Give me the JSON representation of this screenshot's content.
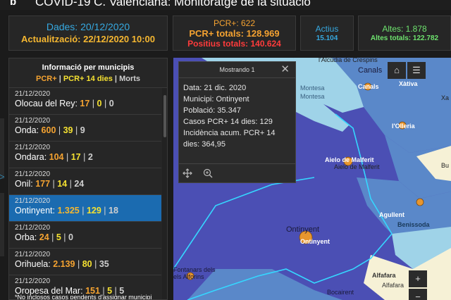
{
  "header": {
    "title": "COVID-19 C. Valenciana: Monitoratge de la situació",
    "logo": "b"
  },
  "dates": {
    "dades": "Dades: 20/12/2020",
    "actualitzacio": "Actualització: 22/12/2020 10:00"
  },
  "pcr": {
    "today": "PCR+: 622",
    "total": "PCR+ totals: 128.969",
    "positius": "Positius totals: 140.624"
  },
  "actius": {
    "label": "Actius",
    "value": "15.104"
  },
  "altes": {
    "label": "Altes: 1.878",
    "total": "Altes totals: 122.782"
  },
  "list": {
    "title": "Informació per municipis",
    "legend": {
      "a": "PCR+",
      "b": "PCR+ 14 dies",
      "c": "Morts",
      "sep": " | "
    },
    "rows": [
      {
        "date": "21/12/2020",
        "name": "Olocau del Rey:",
        "v1": "17",
        "v2": "0",
        "v3": "0"
      },
      {
        "date": "21/12/2020",
        "name": "Onda:",
        "v1": "600",
        "v2": "39",
        "v3": "9"
      },
      {
        "date": "21/12/2020",
        "name": "Ondara:",
        "v1": "104",
        "v2": "17",
        "v3": "2"
      },
      {
        "date": "21/12/2020",
        "name": "Onil:",
        "v1": "177",
        "v2": "14",
        "v3": "24"
      },
      {
        "date": "21/12/2020",
        "name": "Ontinyent:",
        "v1": "1.325",
        "v2": "129",
        "v3": "18"
      },
      {
        "date": "21/12/2020",
        "name": "Orba:",
        "v1": "24",
        "v2": "5",
        "v3": "0"
      },
      {
        "date": "21/12/2020",
        "name": "Orihuela:",
        "v1": "2.139",
        "v2": "80",
        "v3": "35"
      },
      {
        "date": "21/12/2020",
        "name": "Oropesa del Mar:",
        "v1": "151",
        "v2": "5",
        "v3": "5"
      }
    ],
    "selected": 4,
    "footnote": "*No inclosos casos pendents d'assignar municipi"
  },
  "popup": {
    "header": "Mostrando 1",
    "lines": [
      "Data: 21 dic. 2020",
      "Municipi: Ontinyent",
      "Població: 35.347",
      "Casos PCR+ 14 dies: 129",
      "Incidència acum. PCR+ 14",
      "dies: 364,95"
    ]
  },
  "map": {
    "labels": {
      "alcudia": "l'Alcúdia de Crespins",
      "canals1": "Canals",
      "canals2": "Canals",
      "xativa": "Xàtiva",
      "montesa1": "Montesa",
      "montesa2": "Montesa",
      "olleria1": "l'Olleria",
      "olleria2": "l'Olleria",
      "aielo1": "Aielo de Malferit",
      "aielo2": "Aielo de Malferit",
      "ontinyent1": "Ontinyent",
      "ontinyent2": "Ontinyent",
      "aguilent": "Agullent",
      "benissoda": "Benissoda",
      "alforins1": "Fontanars dels",
      "alforins2": "els Alforins",
      "alfafara1": "Alfafara",
      "alfafara2": "Alfafara",
      "bocairent": "Bocairent",
      "xa": "Xa",
      "bu": "Bu"
    },
    "colors": {
      "dark": "#4b4fb4",
      "mid": "#5a88c9",
      "light": "#9fd3e8",
      "pale": "#f6f1d6",
      "border": "#35d7ff",
      "marker": "#e8962e"
    }
  }
}
